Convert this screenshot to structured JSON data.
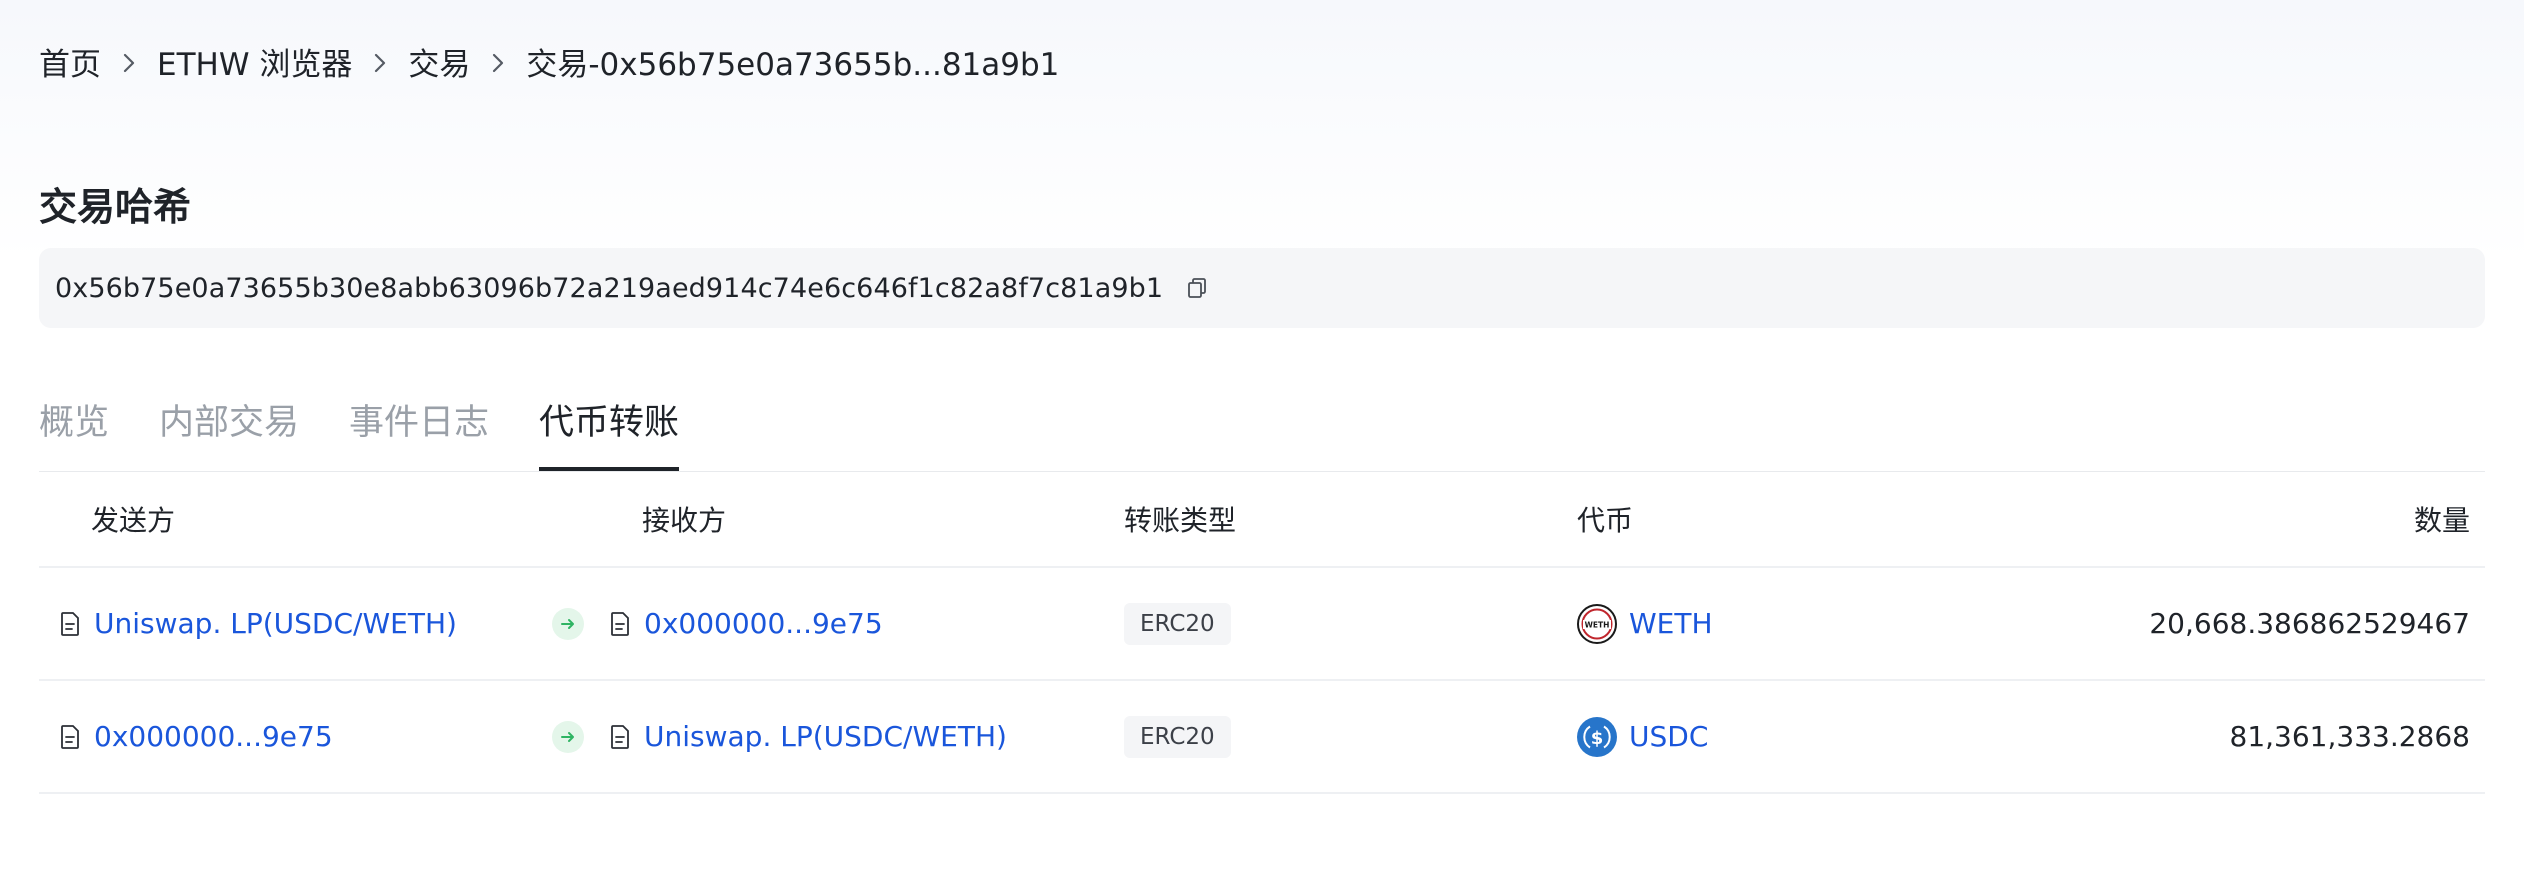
{
  "breadcrumb": {
    "items": [
      "首页",
      "ETHW 浏览器",
      "交易"
    ],
    "current": "交易-0x56b75e0a73655b...81a9b1"
  },
  "title": "交易哈希",
  "hash": "0x56b75e0a73655b30e8abb63096b72a219aed914c74e6c646f1c82a8f7c81a9b1",
  "tabs": [
    {
      "label": "概览",
      "active": false
    },
    {
      "label": "内部交易",
      "active": false
    },
    {
      "label": "事件日志",
      "active": false
    },
    {
      "label": "代币转账",
      "active": true
    }
  ],
  "table": {
    "headers": {
      "from": "发送方",
      "to": "接收方",
      "type": "转账类型",
      "token": "代币",
      "amount": "数量"
    },
    "rows": [
      {
        "from": "Uniswap. LP(USDC/WETH)",
        "to": "0x000000...9e75",
        "type": "ERC20",
        "token": "WETH",
        "token_icon": "weth-token-logo",
        "amount": "20,668.386862529467"
      },
      {
        "from": "0x000000...9e75",
        "to": "Uniswap. LP(USDC/WETH)",
        "type": "ERC20",
        "token": "USDC",
        "token_icon": "usdc-token-logo",
        "amount": "81,361,333.2868"
      }
    ]
  },
  "colors": {
    "link": "#1a56db",
    "arrow_bg": "#e4f6ea",
    "arrow": "#2fb463",
    "usdc": "#2775ca"
  },
  "icons": {
    "breadcrumb_separator": "chevron-right-icon",
    "copy": "copy-icon",
    "contract": "contract-icon",
    "transfer": "arrow-right-icon"
  }
}
